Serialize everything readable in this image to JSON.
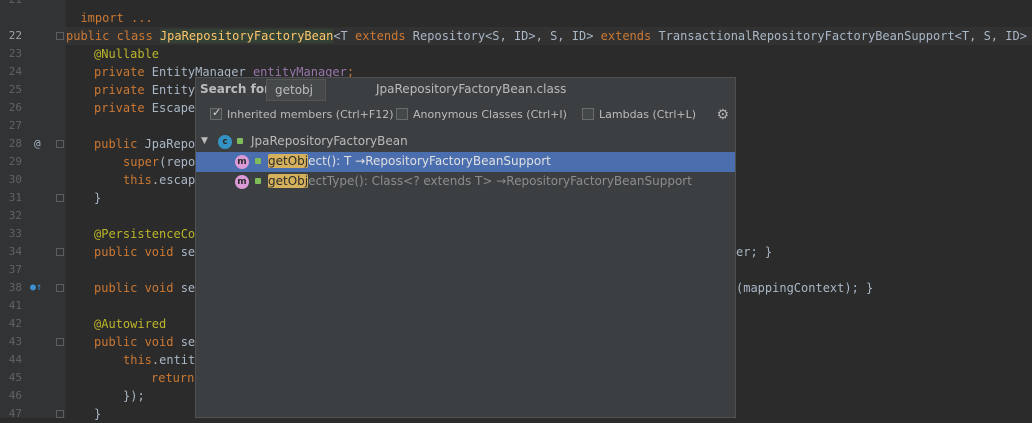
{
  "editor": {
    "line_numbers": [
      "21",
      "22",
      "23",
      "24",
      "25",
      "26",
      "27",
      "28",
      "29",
      "30",
      "31",
      "32",
      "33",
      "34",
      "37",
      "38",
      "41",
      "42",
      "43",
      "44",
      "45",
      "46",
      "47"
    ],
    "line_21": "import ...",
    "line_22_a": "public class ",
    "line_22_b": "JpaRepositoryFactoryBean",
    "line_22_c": "<T ",
    "line_22_d": "extends",
    "line_22_e": " Repository<S, ID>, S, ID> ",
    "line_22_f": "extends",
    "line_22_g": " TransactionalRepositoryFactoryBeanSupport<T, S, ID> {",
    "line_23": "@Nullable",
    "line_24_a": "private",
    "line_24_b": " EntityManager ",
    "line_24_c": "entityManager",
    "line_24_d": ";",
    "line_25_a": "private",
    "line_25_b": " EntityF",
    "line_26_a": "private",
    "line_26_b": " Escape(",
    "line_28_a": "public",
    "line_28_b": " JpaRepos",
    "line_29_a": "super",
    "line_29_b": "(repos",
    "line_30_a": "this",
    "line_30_b": ".escape",
    "line_31": "}",
    "line_33": "@PersistenceCon",
    "line_34_a": "public void",
    "line_34_b": " set",
    "line_34_r": "er; }",
    "line_38_a": "public void",
    "line_38_b": " set",
    "line_38_r": "(mappingContext); }",
    "line_42": "@Autowired",
    "line_43_a": "public void",
    "line_43_b": " set",
    "line_44_a": "this",
    "line_44_b": ".entity",
    "line_45_a": "return",
    "line_46": "});",
    "line_47": "}"
  },
  "popup": {
    "search_label": "Search for:",
    "search_value": "getobj",
    "title": "JpaRepositoryFactoryBean.class",
    "options": {
      "inherited": "Inherited members (Ctrl+F12)",
      "anonymous": "Anonymous Classes (Ctrl+I)",
      "lambdas": "Lambdas (Ctrl+L)"
    },
    "tree": {
      "class_name": "JpaRepositoryFactoryBean",
      "items": [
        {
          "match": "getObj",
          "rest": "ect(): T →RepositoryFactoryBeanSupport"
        },
        {
          "match": "getObj",
          "rest": "ectType(): Class<? extends T> →RepositoryFactoryBeanSupport"
        }
      ]
    }
  },
  "colors": {
    "background": "#2b2b2b",
    "selection": "#4b6eaf",
    "keyword": "#cc7832",
    "match_highlight": "#d6b15c"
  }
}
